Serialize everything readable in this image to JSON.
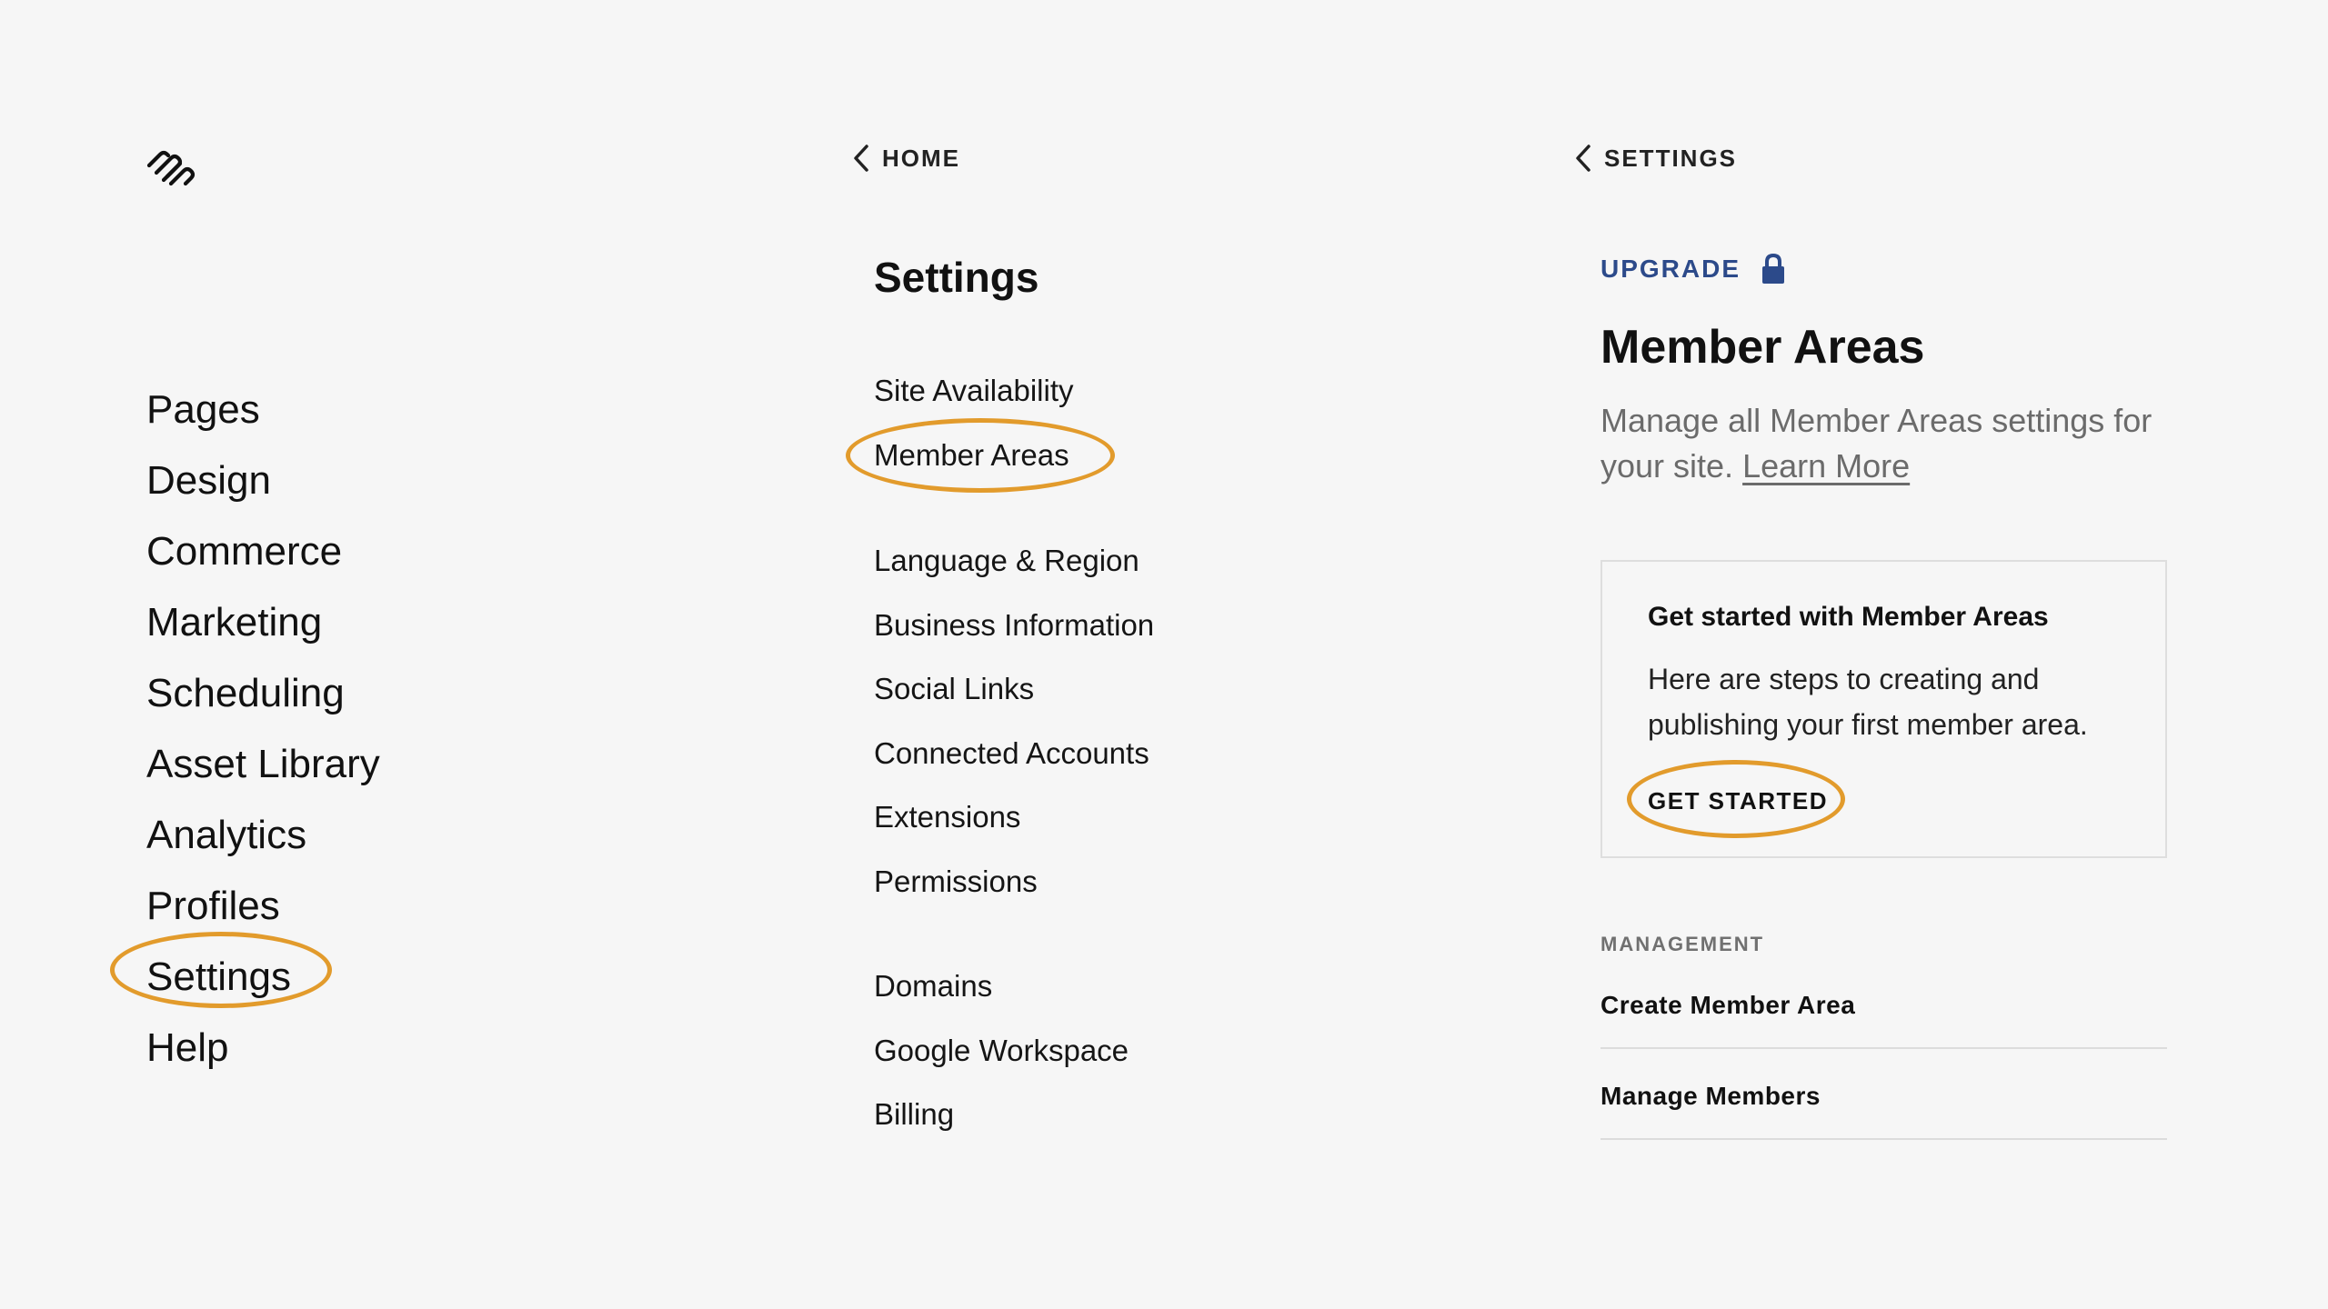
{
  "brand": {
    "logo_icon": "squarespace-logo-icon"
  },
  "main_nav": {
    "items": [
      "Pages",
      "Design",
      "Commerce",
      "Marketing",
      "Scheduling",
      "Asset Library",
      "Analytics",
      "Profiles",
      "Settings",
      "Help"
    ],
    "highlighted": "Settings"
  },
  "settings_panel": {
    "back_label": "HOME",
    "title": "Settings",
    "group1": [
      "Site Availability",
      "Member Areas"
    ],
    "group2": [
      "Language & Region",
      "Business Information",
      "Social Links",
      "Connected Accounts",
      "Extensions",
      "Permissions"
    ],
    "group3": [
      "Domains",
      "Google Workspace",
      "Billing"
    ],
    "highlighted": "Member Areas"
  },
  "member_areas": {
    "back_label": "SETTINGS",
    "upgrade_label": "UPGRADE",
    "upgrade_icon": "lock-icon",
    "title": "Member Areas",
    "description": "Manage all Member Areas settings for your site.",
    "learn_more": "Learn More",
    "card": {
      "title": "Get started with Member Areas",
      "body": "Here are steps to creating and publishing your first member area.",
      "button": "GET STARTED"
    },
    "management": {
      "label": "MANAGEMENT",
      "items": [
        "Create Member Area",
        "Manage Members"
      ]
    }
  },
  "colors": {
    "background": "#f6f6f6",
    "highlight_ring": "#e29b2c",
    "upgrade_blue": "#2c4a8a",
    "muted_text": "#6b6b6b"
  }
}
